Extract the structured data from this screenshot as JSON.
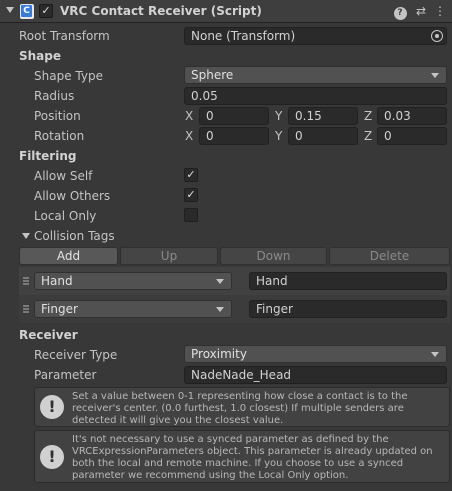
{
  "header": {
    "title": "VRC Contact Receiver (Script)",
    "checkbox": "✓",
    "help_icon": "?",
    "preset_icon": "⇄",
    "menu_icon": "⋮"
  },
  "root_transform": {
    "label": "Root Transform",
    "value": "None (Transform)"
  },
  "shape": {
    "section_label": "Shape",
    "shape_type": {
      "label": "Shape Type",
      "value": "Sphere"
    },
    "radius": {
      "label": "Radius",
      "value": "0.05"
    },
    "position": {
      "label": "Position",
      "x_label": "X",
      "x": "0",
      "y_label": "Y",
      "y": "0.15",
      "z_label": "Z",
      "z": "0.03"
    },
    "rotation": {
      "label": "Rotation",
      "x_label": "X",
      "x": "0",
      "y_label": "Y",
      "y": "0",
      "z_label": "Z",
      "z": "0"
    }
  },
  "filtering": {
    "section_label": "Filtering",
    "allow_self": {
      "label": "Allow Self",
      "checked": "✓"
    },
    "allow_others": {
      "label": "Allow Others",
      "checked": "✓"
    },
    "local_only": {
      "label": "Local Only",
      "checked": ""
    }
  },
  "collision_tags": {
    "label": "Collision Tags",
    "buttons": {
      "add": "Add",
      "up": "Up",
      "down": "Down",
      "delete": "Delete"
    },
    "items": [
      {
        "dropdown": "Hand",
        "value": "Hand"
      },
      {
        "dropdown": "Finger",
        "value": "Finger"
      }
    ]
  },
  "receiver": {
    "section_label": "Receiver",
    "receiver_type": {
      "label": "Receiver Type",
      "value": "Proximity"
    },
    "parameter": {
      "label": "Parameter",
      "value": "NadeNade_Head"
    }
  },
  "help_boxes": [
    {
      "icon": "!",
      "text": "Set a value between 0-1 representing how close a contact is to the receiver's center. (0.0 furthest, 1.0 closest)  If multiple senders are detected it will give you the closest value."
    },
    {
      "icon": "!",
      "text": "It's not necessary to use a synced parameter as defined by the VRCExpressionParameters object.  This parameter is already updated on both the local and remote machine.  If you choose to use a synced parameter we recommend using the Local Only option."
    }
  ],
  "colors": {
    "background": "#383838",
    "field": "#2a2a2a",
    "dropdown": "#515151",
    "text": "#c4c4c4"
  }
}
